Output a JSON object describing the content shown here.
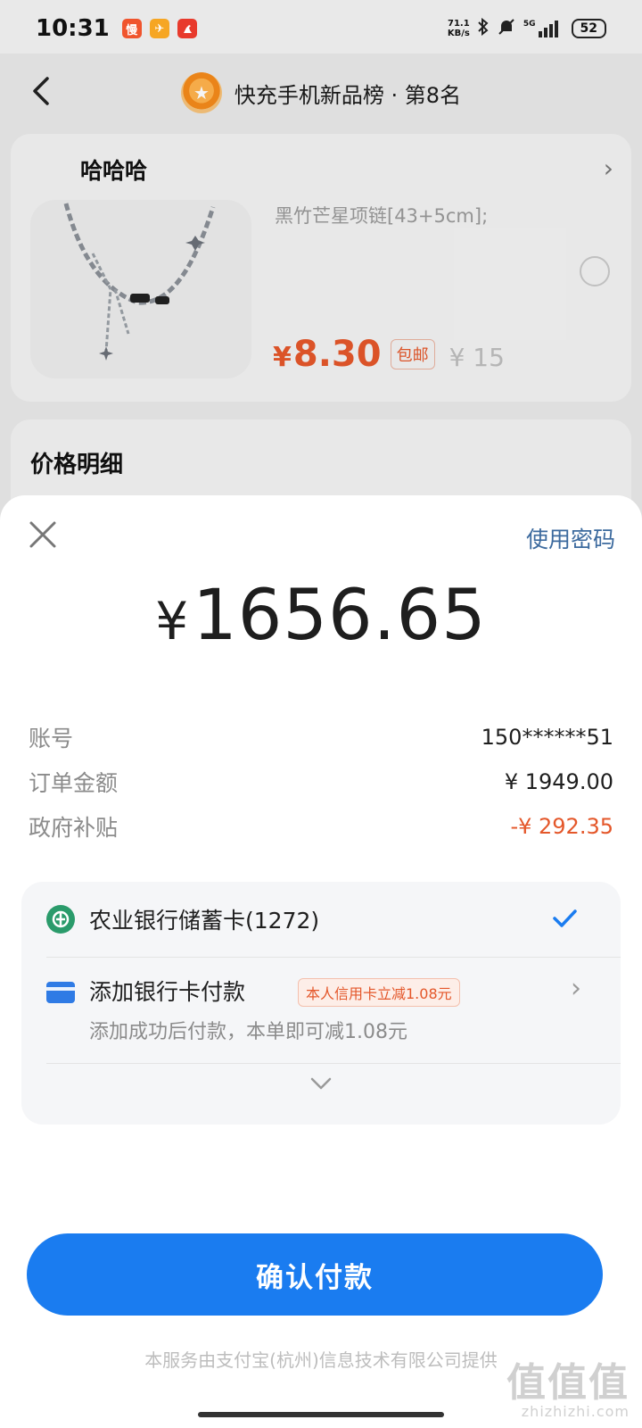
{
  "status_bar": {
    "time": "10:31",
    "app_badges": [
      {
        "icon": "slow-app-icon",
        "glyph": "慢",
        "color": "#f0542d"
      },
      {
        "icon": "plane-app-icon",
        "glyph": "✈",
        "color": "#f6a623"
      },
      {
        "icon": "kangaroo-app-icon",
        "glyph": "🦘",
        "color": "#e83a2c"
      }
    ],
    "net_speed_value": "71.1",
    "net_speed_unit": "KB/s",
    "network": "5G",
    "battery": "52"
  },
  "header": {
    "title": "快充手机新品榜 · 第8名"
  },
  "product": {
    "store_name": "哈哈哈",
    "description": "黑竹芒星项链[43+5cm];",
    "price_symbol": "¥",
    "price_value": "8.30",
    "shipping_badge": "包邮",
    "original_price": "¥ 15"
  },
  "price_detail": {
    "title": "价格明细"
  },
  "payment": {
    "use_password_label": "使用密码",
    "amount_symbol": "¥",
    "amount_value": "1656.65",
    "rows": [
      {
        "label": "账号",
        "value": "150******51"
      },
      {
        "label": "订单金额",
        "value": "¥ 1949.00"
      },
      {
        "label": "政府补贴",
        "value": "-¥ 292.35"
      }
    ],
    "discount_color": "#e4572a",
    "selected_method": {
      "name": "农业银行储蓄卡(1272)"
    },
    "add_card": {
      "label": "添加银行卡付款",
      "promo": "本人信用卡立减1.08元",
      "subtitle": "添加成功后付款，本单即可减1.08元"
    },
    "confirm_label": "确认付款",
    "accent_color": "#1a7cf0",
    "footer_note": "本服务由支付宝(杭州)信息技术有限公司提供"
  },
  "watermark": {
    "mark": "值值值",
    "site": "zhizhizhi.com"
  }
}
